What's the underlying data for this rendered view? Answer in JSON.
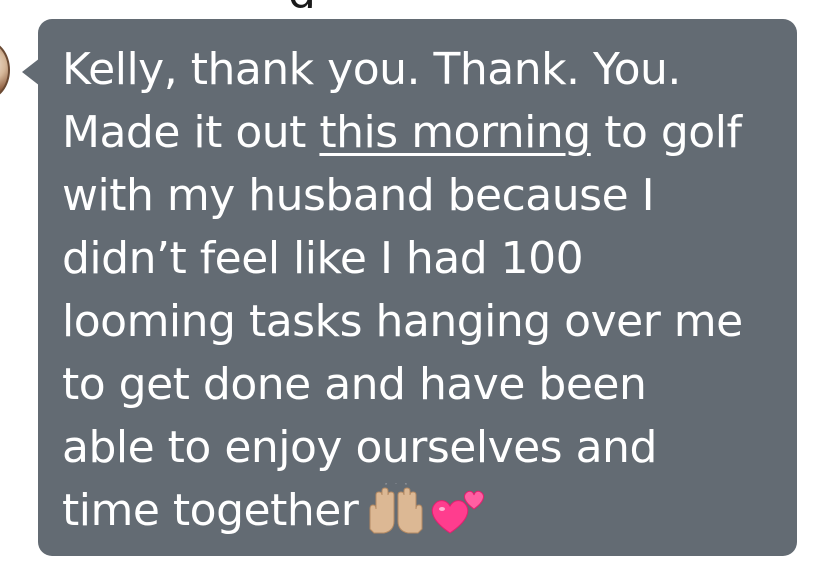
{
  "previous_message": {
    "tail_text": "g"
  },
  "message": {
    "line_1": "Kelly, thank you. Thank. You.",
    "line_2_before": "Made it out ",
    "line_2_link": "this morning",
    "line_2_after": " to golf",
    "line_3": "with my husband because I",
    "line_4": "didn’t feel like I had 100",
    "line_5": "looming tasks hanging over me",
    "line_6": "to get done and have been",
    "line_7": "able to enjoy ourselves and",
    "line_8": "time together",
    "emojis": [
      "raising-hands-emoji",
      "two-hearts-emoji"
    ]
  },
  "colors": {
    "bubble": "#636b73",
    "text": "#ffffff",
    "background": "#ffffff"
  }
}
